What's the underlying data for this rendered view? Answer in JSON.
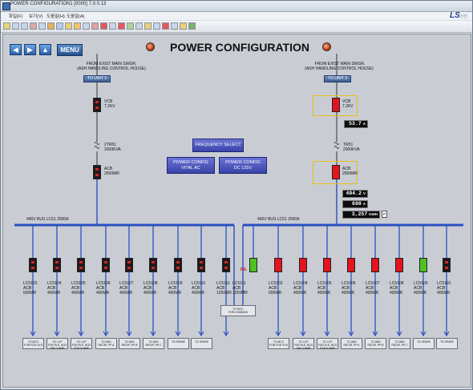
{
  "window": {
    "title": "POWER CONFIGURATION1 [0000] 7.0.0.13",
    "menu": [
      "화일(F)",
      "보기(V)",
      "도움말(H)",
      "도움말(A)"
    ],
    "logo": "LS",
    "logo_sub": "산전"
  },
  "header": {
    "title": "POWER CONFIGURATION",
    "menu_label": "MENU"
  },
  "center": {
    "frequency_select": "FREQUENCY SELECT",
    "power_config_ac_1": "POWER CONFIG",
    "power_config_ac_2": "VITAL AC",
    "power_config_dc_1": "POWER CONFIG",
    "power_config_dc_2": "DC 125V"
  },
  "units": [
    {
      "source_1": "FROM EXIST MAIN SWGR.",
      "source_2": "(ASH HANDLING CONTROL HOUSE)",
      "unit_button": "TO UNIT 1",
      "vcb_1": "VCB",
      "vcb_2": "7.2KV",
      "tr_1": "2TR51",
      "tr_2": "2000KVA",
      "acb_1": "ACB",
      "acb_2": "2500MR",
      "bus": "440V BUS LC51 2500A"
    },
    {
      "source_1": "FROM EXIST MAIN SWGR.",
      "source_2": "(ASH HANDLING CONTROL HOUSE)",
      "unit_button": "TO UNIT 2",
      "vcb_1": "VCB",
      "vcb_2": "7.2KV",
      "tr_1": "TR51",
      "tr_2": "2000KVA",
      "acb_1": "ACB",
      "acb_2": "2500MR",
      "bus": "440V BUS LC51 2500A",
      "vcb_current": "53.7",
      "vcb_current_unit": "A",
      "voltage": "494.2",
      "voltage_unit": "V",
      "current": "698",
      "current_unit": "A",
      "energy": "3,257",
      "energy_unit": "KWH",
      "energy_tag": "P"
    }
  ],
  "feeders_left": [
    {
      "name": "LC5102",
      "type": "ACB",
      "rating": "600MR",
      "load_1": "TO MCC",
      "load_2": "FOR FGD SYS",
      "status": "off"
    },
    {
      "name": "LC5104",
      "type": "ACB",
      "rating": "400MR",
      "load_1": "TO LCP",
      "load_2": "FOR ELE. BOX",
      "load_3": "OIB G-BMP",
      "status": "off"
    },
    {
      "name": "LC5105",
      "type": "ACB",
      "rating": "400MR",
      "load_1": "TO LCP",
      "load_2": "FOR ELE. BOX",
      "load_3": "FGB H-BMP",
      "status": "off"
    },
    {
      "name": "LC5106",
      "type": "ACB",
      "rating": "400MR",
      "load_1": "TO ABS",
      "load_2": "RECIR. PP A",
      "status": "off"
    },
    {
      "name": "LC5107",
      "type": "ACB",
      "rating": "400MR",
      "load_1": "TO ABS",
      "load_2": "RECIR. PP B",
      "status": "off"
    },
    {
      "name": "LC5108",
      "type": "ACB",
      "rating": "400MR",
      "load_1": "TO ABS",
      "load_2": "RECIR. PP C",
      "status": "off"
    },
    {
      "name": "LC5109",
      "type": "ACB",
      "rating": "400MR",
      "load_1": "TO SPARE",
      "status": "off"
    },
    {
      "name": "LC5110",
      "type": "ACB",
      "rating": "400MR",
      "load_1": "TO SPARE",
      "status": "off"
    },
    {
      "name": "LC5111",
      "type": "ACB",
      "rating": "1250MR",
      "status": "off"
    }
  ],
  "tie": {
    "name": "LC5111",
    "type": "ACB",
    "rating": "1250MR",
    "load_1": "TO MCC",
    "load_2": "FOR COMMON",
    "flag": "RG",
    "status": "green"
  },
  "feeders_right": [
    {
      "name": "LC5102",
      "type": "ACB",
      "rating": "600MR",
      "load_1": "TO MCC",
      "load_2": "FOR FGD SYS",
      "status": "red"
    },
    {
      "name": "LC5104",
      "type": "ACB",
      "rating": "400MR",
      "load_1": "TO LCP",
      "load_2": "FOR ELE. BOX",
      "load_3": "OIB G-BMP",
      "status": "red"
    },
    {
      "name": "LC5105",
      "type": "ACB",
      "rating": "400MR",
      "load_1": "TO LCP",
      "load_2": "FOR ELE. BOX",
      "load_3": "FGB H-BMP",
      "status": "red"
    },
    {
      "name": "LC5106",
      "type": "ACB",
      "rating": "400MR",
      "load_1": "TO ABS",
      "load_2": "RECIR. PP A",
      "status": "red"
    },
    {
      "name": "LC5107",
      "type": "ACB",
      "rating": "400MR",
      "load_1": "TO ABS",
      "load_2": "RECIR. PP B",
      "status": "red"
    },
    {
      "name": "LC5108",
      "type": "ACB",
      "rating": "400MR",
      "load_1": "TO ABS",
      "load_2": "RECIR. PP C",
      "status": "red"
    },
    {
      "name": "LC5109",
      "type": "ACB",
      "rating": "400MR",
      "load_1": "TO SPARE",
      "status": "green"
    },
    {
      "name": "LC5110",
      "type": "ACB",
      "rating": "400MR",
      "load_1": "TO SPARE",
      "status": "off"
    }
  ],
  "colors": {
    "bus": "#2b4fc2",
    "breaker_closed": "#e2141c",
    "breaker_green": "#4ec01f",
    "breaker_off": "#1b1b1b",
    "screen_bg": "#c9cdd3"
  }
}
